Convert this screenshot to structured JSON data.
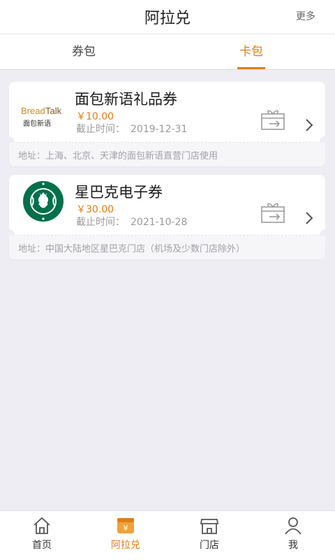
{
  "header": {
    "title": "阿拉兑",
    "more_label": "更多"
  },
  "tabs": [
    {
      "label": "券包",
      "active": false
    },
    {
      "label": "卡包",
      "active": true
    }
  ],
  "coupons": [
    {
      "brand": "BreadTalk",
      "brand_sub": "面包新语",
      "name": "面包新语礼品券",
      "price": "￥10.00",
      "expiry_label": "截止时间：",
      "expiry_date": "2019-12-31",
      "address": "地址：上海、北京、天津的面包新语直营门店使用"
    },
    {
      "brand": "Starbucks",
      "name": "星巴克电子券",
      "price": "￥30.00",
      "expiry_label": "截止时间：",
      "expiry_date": "2021-10-28",
      "address": "地址：中国大陆地区星巴克门店（机场及少数门店除外）"
    }
  ],
  "bottom_nav": [
    {
      "label": "首页",
      "icon": "home-icon",
      "active": false
    },
    {
      "label": "阿拉兑",
      "icon": "wallet-icon",
      "active": true
    },
    {
      "label": "门店",
      "icon": "store-icon",
      "active": false
    },
    {
      "label": "我",
      "icon": "user-icon",
      "active": false
    }
  ],
  "colors": {
    "accent": "#e07d12",
    "background": "#efedf4",
    "starbucks_green": "#00704a"
  }
}
